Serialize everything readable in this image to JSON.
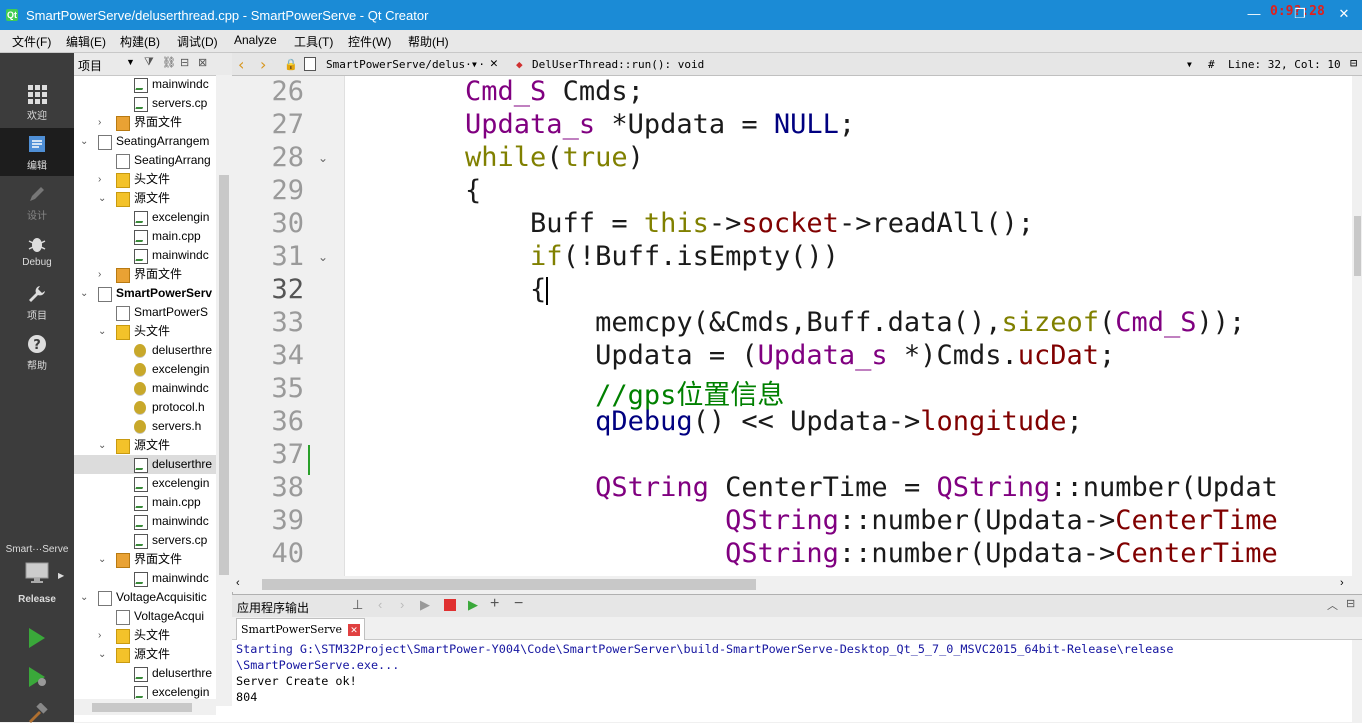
{
  "window": {
    "title": "SmartPowerServe/deluserthread.cpp - SmartPowerServe - Qt Creator",
    "clock": "0:9?:28"
  },
  "menu": [
    "文件(F)",
    "编辑(E)",
    "构建(B)",
    "调试(D)",
    "Analyze",
    "工具(T)",
    "控件(W)",
    "帮助(H)"
  ],
  "modes": [
    {
      "label": "欢迎",
      "icon": "grid-icon"
    },
    {
      "label": "编辑",
      "icon": "edit-doc-icon"
    },
    {
      "label": "设计",
      "icon": "pencil-icon"
    },
    {
      "label": "Debug",
      "icon": "bug-icon"
    },
    {
      "label": "项目",
      "icon": "wrench-icon"
    },
    {
      "label": "帮助",
      "icon": "help-icon"
    }
  ],
  "kit": {
    "project": "Smart···Serve",
    "config": "Release"
  },
  "project_tree": {
    "header": "项目",
    "rows": [
      {
        "indent": 2,
        "icon": "cpp",
        "label": "mainwindc"
      },
      {
        "indent": 2,
        "icon": "cpp",
        "label": "servers.cp"
      },
      {
        "indent": 1,
        "icon": "ui",
        "label": "界面文件",
        "arrow": ">"
      },
      {
        "indent": 0,
        "icon": "pro",
        "label": "SeatingArrangem",
        "arrow": "v"
      },
      {
        "indent": 1,
        "icon": "pro",
        "label": "SeatingArrang"
      },
      {
        "indent": 1,
        "icon": "folder",
        "label": "头文件",
        "arrow": ">"
      },
      {
        "indent": 1,
        "icon": "folder",
        "label": "源文件",
        "arrow": "v"
      },
      {
        "indent": 2,
        "icon": "cpp",
        "label": "excelengin"
      },
      {
        "indent": 2,
        "icon": "cpp",
        "label": "main.cpp"
      },
      {
        "indent": 2,
        "icon": "cpp",
        "label": "mainwindc"
      },
      {
        "indent": 1,
        "icon": "ui",
        "label": "界面文件",
        "arrow": ">"
      },
      {
        "indent": 0,
        "icon": "pro",
        "label": "SmartPowerServ",
        "arrow": "v",
        "bold": true
      },
      {
        "indent": 1,
        "icon": "pro",
        "label": "SmartPowerS"
      },
      {
        "indent": 1,
        "icon": "folder",
        "label": "头文件",
        "arrow": "v"
      },
      {
        "indent": 2,
        "icon": "hdr",
        "label": "deluserthre"
      },
      {
        "indent": 2,
        "icon": "hdr",
        "label": "excelengin"
      },
      {
        "indent": 2,
        "icon": "hdr",
        "label": "mainwindc"
      },
      {
        "indent": 2,
        "icon": "hdr",
        "label": "protocol.h"
      },
      {
        "indent": 2,
        "icon": "hdr",
        "label": "servers.h"
      },
      {
        "indent": 1,
        "icon": "folder",
        "label": "源文件",
        "arrow": "v"
      },
      {
        "indent": 2,
        "icon": "cpp",
        "label": "deluserthre",
        "selected": true
      },
      {
        "indent": 2,
        "icon": "cpp",
        "label": "excelengin"
      },
      {
        "indent": 2,
        "icon": "cpp",
        "label": "main.cpp"
      },
      {
        "indent": 2,
        "icon": "cpp",
        "label": "mainwindc"
      },
      {
        "indent": 2,
        "icon": "cpp",
        "label": "servers.cp"
      },
      {
        "indent": 1,
        "icon": "ui",
        "label": "界面文件",
        "arrow": "v"
      },
      {
        "indent": 2,
        "icon": "cpp",
        "label": "mainwindc"
      },
      {
        "indent": 0,
        "icon": "pro",
        "label": "VoltageAcquisitic",
        "arrow": "v"
      },
      {
        "indent": 1,
        "icon": "pro",
        "label": "VoltageAcqui"
      },
      {
        "indent": 1,
        "icon": "folder",
        "label": "头文件",
        "arrow": ">"
      },
      {
        "indent": 1,
        "icon": "folder",
        "label": "源文件",
        "arrow": "v"
      },
      {
        "indent": 2,
        "icon": "cpp",
        "label": "deluserthre"
      },
      {
        "indent": 2,
        "icon": "cpp",
        "label": "excelengin"
      }
    ]
  },
  "editor_toolbar": {
    "file": "SmartPowerServe/delus···",
    "symbol": "DelUserThread::run(): void",
    "hash": "#",
    "position": "Line: 32, Col: 10"
  },
  "editor": {
    "current_line": 32,
    "lines": [
      {
        "n": "26",
        "fold": "",
        "tokens": [
          {
            "t": "    "
          },
          {
            "c": "ty",
            "t": "Cmd_S"
          },
          {
            "t": " Cmds;"
          }
        ]
      },
      {
        "n": "27",
        "fold": "",
        "tokens": [
          {
            "t": "    "
          },
          {
            "c": "ty",
            "t": "Updata_s"
          },
          {
            "t": " *Updata = "
          },
          {
            "c": "nl",
            "t": "NULL"
          },
          {
            "t": ";"
          }
        ]
      },
      {
        "n": "28",
        "fold": "v",
        "tokens": [
          {
            "t": "    "
          },
          {
            "c": "kw",
            "t": "while"
          },
          {
            "t": "("
          },
          {
            "c": "kw",
            "t": "true"
          },
          {
            "t": ")"
          }
        ]
      },
      {
        "n": "29",
        "fold": "",
        "tokens": [
          {
            "t": "    {"
          }
        ]
      },
      {
        "n": "30",
        "fold": "",
        "tokens": [
          {
            "t": "        Buff = "
          },
          {
            "c": "kw",
            "t": "this"
          },
          {
            "t": "->"
          },
          {
            "c": "mb",
            "t": "socket"
          },
          {
            "t": "->readAll();"
          }
        ]
      },
      {
        "n": "31",
        "fold": "v",
        "tokens": [
          {
            "t": "        "
          },
          {
            "c": "kw",
            "t": "if"
          },
          {
            "t": "(!Buff.isEmpty())"
          }
        ]
      },
      {
        "n": "32",
        "fold": "",
        "tokens": [
          {
            "t": "        {"
          }
        ]
      },
      {
        "n": "33",
        "fold": "",
        "tokens": [
          {
            "t": "            memcpy(&Cmds,Buff.data(),"
          },
          {
            "c": "kw",
            "t": "sizeof"
          },
          {
            "t": "("
          },
          {
            "c": "ty",
            "t": "Cmd_S"
          },
          {
            "t": "));"
          }
        ]
      },
      {
        "n": "34",
        "fold": "",
        "tokens": [
          {
            "t": "            Updata = ("
          },
          {
            "c": "ty",
            "t": "Updata_s"
          },
          {
            "t": " *)Cmds."
          },
          {
            "c": "mb",
            "t": "ucDat"
          },
          {
            "t": ";"
          }
        ]
      },
      {
        "n": "35",
        "fold": "",
        "tokens": [
          {
            "t": "            "
          },
          {
            "c": "cm",
            "t": "//gps位置信息"
          }
        ]
      },
      {
        "n": "36",
        "fold": "",
        "tokens": [
          {
            "t": "            "
          },
          {
            "c": "nl",
            "t": "qDebug"
          },
          {
            "t": "() << Updata->"
          },
          {
            "c": "mb",
            "t": "longitude"
          },
          {
            "t": ";"
          }
        ]
      },
      {
        "n": "37",
        "fold": "",
        "tokens": [
          {
            "t": ""
          }
        ]
      },
      {
        "n": "38",
        "fold": "",
        "tokens": [
          {
            "t": "            "
          },
          {
            "c": "ty",
            "t": "QString"
          },
          {
            "t": " CenterTime = "
          },
          {
            "c": "ty",
            "t": "QString"
          },
          {
            "t": "::number(Updat"
          }
        ]
      },
      {
        "n": "39",
        "fold": "",
        "tokens": [
          {
            "t": "                    "
          },
          {
            "c": "ty",
            "t": "QString"
          },
          {
            "t": "::number(Updata->"
          },
          {
            "c": "mb",
            "t": "CenterTime"
          }
        ]
      },
      {
        "n": "40",
        "fold": "",
        "tokens": [
          {
            "t": "                    "
          },
          {
            "c": "ty",
            "t": "QString"
          },
          {
            "t": "::number(Updata->"
          },
          {
            "c": "mb",
            "t": "CenterTime"
          }
        ]
      }
    ]
  },
  "output": {
    "title": "应用程序输出",
    "tab": "SmartPowerServe",
    "lines": [
      {
        "text": "Starting G:\\STM32Project\\SmartPower-Y004\\Code\\SmartPowerServer\\build-SmartPowerServe-Desktop_Qt_5_7_0_MSVC2015_64bit-Release\\release",
        "blue": true
      },
      {
        "text": "\\SmartPowerServe.exe...",
        "blue": true
      },
      {
        "text": "Server Create ok!",
        "blue": false
      },
      {
        "text": "804",
        "blue": false
      }
    ]
  }
}
